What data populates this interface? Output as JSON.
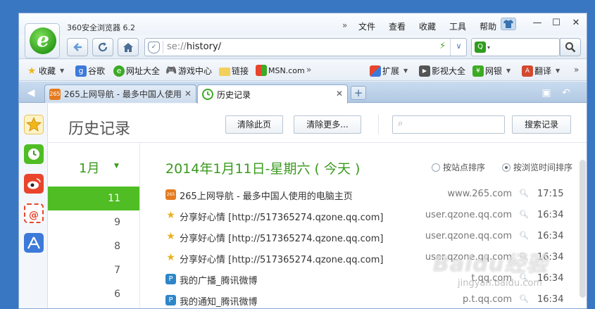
{
  "titlebar": {
    "app_title": "360安全浏览器 6.2",
    "menu": [
      "文件",
      "查看",
      "收藏",
      "工具",
      "帮助"
    ],
    "overflow": "»",
    "skin_icon": "tshirt-icon",
    "min": "—",
    "max": "☐",
    "close": "✕"
  },
  "nav": {
    "url_scheme": "se://",
    "url_path": "history/",
    "bolt": "⚡",
    "dropdown": "∨",
    "search_engine": "Q",
    "search_placeholder": ""
  },
  "favorites": {
    "items": [
      {
        "label": "收藏",
        "icon": "star-icon",
        "has_caret": true
      },
      {
        "label": "谷歌",
        "icon": "google-icon"
      },
      {
        "label": "网址大全",
        "icon": "url-directory-icon"
      },
      {
        "label": "游戏中心",
        "icon": "gamepad-icon"
      },
      {
        "label": "链接",
        "icon": "folder-icon"
      },
      {
        "label": "MSN.com",
        "icon": "msn-icon"
      }
    ],
    "more": "»",
    "right_items": [
      {
        "label": "扩展",
        "icon": "extension-icon",
        "has_caret": true
      },
      {
        "label": "影视大全",
        "icon": "video-icon"
      },
      {
        "label": "网银",
        "icon": "bank-icon",
        "has_caret": true
      },
      {
        "label": "翻译",
        "icon": "translate-icon",
        "has_caret": true
      }
    ],
    "right_more": "»"
  },
  "tabs": [
    {
      "label": "265上网导航 - 最多中国人使用",
      "active": false,
      "close": "✕"
    },
    {
      "label": "历史记录",
      "active": true,
      "close": "✕"
    }
  ],
  "new_tab": "+",
  "page": {
    "title": "历史记录",
    "clear_page_btn": "清除此页",
    "clear_more_btn": "清除更多...",
    "search_btn": "搜索记录",
    "search_value": ""
  },
  "dates": {
    "month": "1月",
    "days": [
      "11",
      "9",
      "8",
      "7",
      "6"
    ]
  },
  "history": {
    "date_title": "2014年1月11日-星期六 ( 今天 )",
    "sort_by_site": "按站点排序",
    "sort_by_time": "按浏览时间排序",
    "rows": [
      {
        "title": "265上网导航 - 最多中国人使用的电脑主页",
        "domain": "www.265.com",
        "time": "17:15",
        "icon": "265-site-icon"
      },
      {
        "title": "分享好心情 [http://517365274.qzone.qq.com]",
        "domain": "user.qzone.qq.com",
        "time": "16:34",
        "icon": "qzone-star-icon"
      },
      {
        "title": "分享好心情 [http://517365274.qzone.qq.com]",
        "domain": "user.qzone.qq.com",
        "time": "16:34",
        "icon": "qzone-star-icon"
      },
      {
        "title": "分享好心情 [http://517365274.qzone.qq.com]",
        "domain": "user.qzone.qq.com",
        "time": "16:34",
        "icon": "qzone-star-icon"
      },
      {
        "title": "我的广播_腾讯微博",
        "domain": "t.qq.com",
        "time": "16:34",
        "icon": "tencent-weibo-icon"
      },
      {
        "title": "我的通知_腾讯微博",
        "domain": "p.t.qq.com",
        "time": "16:34",
        "icon": "tencent-weibo-icon"
      }
    ]
  },
  "watermark": {
    "text": "Baidu经验",
    "sub": "jingyan.baidu.com"
  },
  "colors": {
    "accent_green": "#4fbd23",
    "title_green": "#3a9a1e",
    "frame_blue": "#3a77c2"
  }
}
